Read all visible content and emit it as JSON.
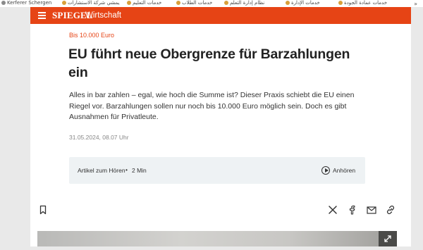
{
  "bookmarks": {
    "items": [
      {
        "label": "Kerferer Schergen"
      },
      {
        "label": "يمشي شركة الاستشارات"
      },
      {
        "label": "خدمات التعليم"
      },
      {
        "label": "خدمات الطلاب"
      },
      {
        "label": "نظام إدارة التعلم"
      },
      {
        "label": "خدمات الإدارة"
      },
      {
        "label": "خدمات عمادة الجودة"
      }
    ],
    "more": "»"
  },
  "header": {
    "logo": "SPIEGEL",
    "section": "Wirtschaft",
    "menu_icon": "hamburger-icon",
    "accent_color": "#e64415"
  },
  "article": {
    "kicker": "Bis 10.000 Euro",
    "headline": "EU führt neue Obergrenze für Barzahlungen ein",
    "lead": "Alles in bar zahlen – egal, wie hoch die Summe ist? Dieser Praxis schiebt die EU einen Riegel vor. Barzahlungen sollen nur noch bis 10.000 Euro möglich sein. Doch es gibt Ausnahmen für Privatleute.",
    "date": "31.05.2024, 08.07 Uhr",
    "audio": {
      "label": "Artikel zum Hören",
      "separator": "•",
      "duration": "2 Min",
      "play_label": "Anhören",
      "play_icon": "play-circle-icon"
    },
    "actions": {
      "bookmark_icon": "bookmark-icon",
      "share_icons": [
        "x-icon",
        "facebook-icon",
        "mail-icon",
        "link-icon"
      ]
    }
  }
}
